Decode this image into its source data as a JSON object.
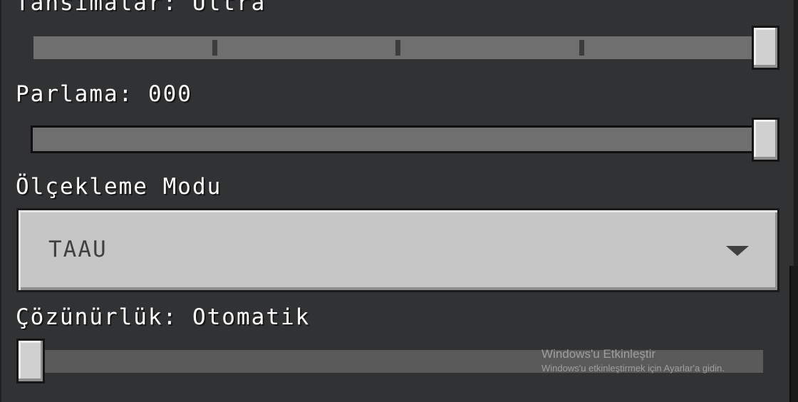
{
  "settings": {
    "shadows": {
      "label": "Tahsimalar: Ultra",
      "level_index": 4,
      "level_count": 5
    },
    "brightness": {
      "label": "Parlama: 000",
      "value_fraction": 1.0
    },
    "upscaling_mode": {
      "label": "Ölçekleme Modu",
      "selected": "TAAU",
      "icon": "chevron-down-icon"
    },
    "resolution": {
      "label": "Çözünürlük: Otomatik",
      "value_fraction": 0.0
    }
  },
  "watermark": {
    "title": "Windows'u Etkinleştir",
    "subtitle": "Windows'u etkinleştirmek için Ayarlar'a gidin."
  },
  "colors": {
    "background": "#313233",
    "track": "#6f6f6f",
    "thumb": "#d0d0d1",
    "dropdown": "#c6c6c6"
  }
}
